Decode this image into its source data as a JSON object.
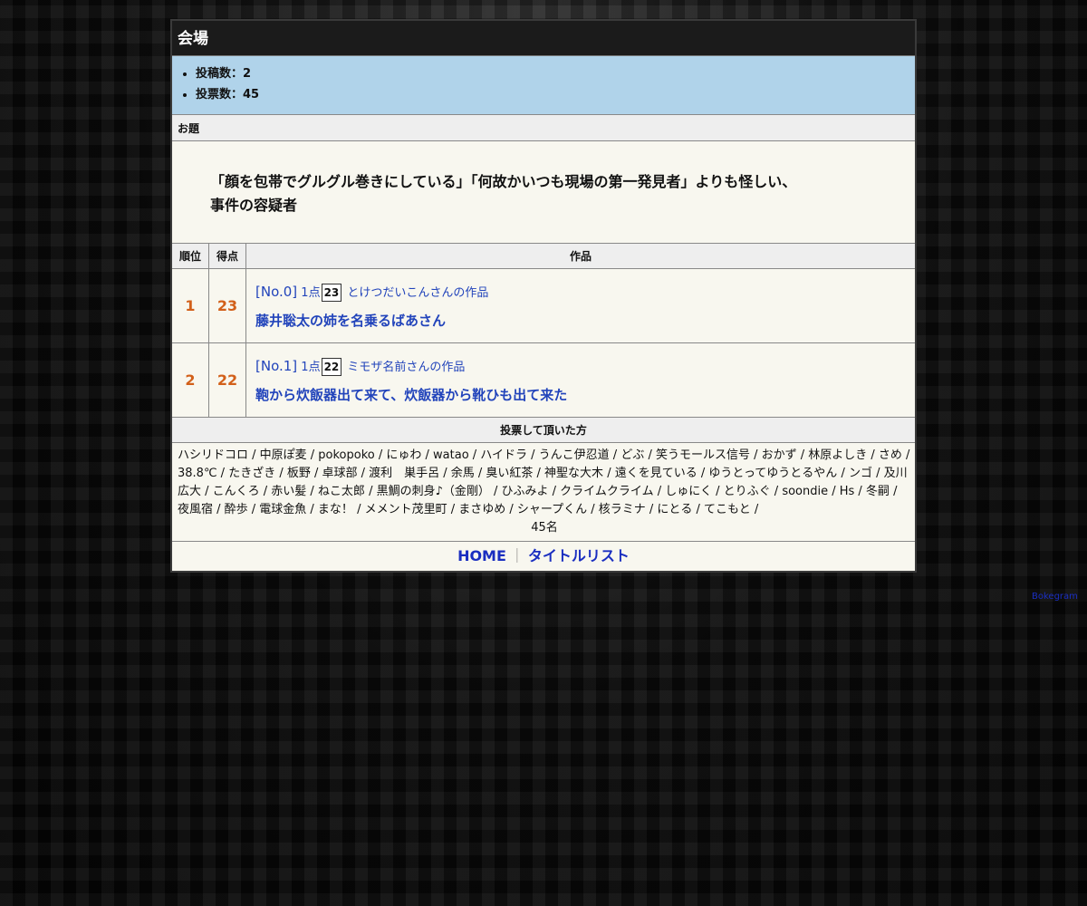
{
  "venue": {
    "title": "会場",
    "stats": [
      "投稿数：2",
      "投票数：45"
    ]
  },
  "theme": {
    "label": "お題",
    "line1": "「顔を包帯でグルグル巻きにしている」「何故かいつも現場の第一発見者」よりも怪しい、",
    "line2": "事件の容疑者"
  },
  "ranking": {
    "headers": {
      "rank": "順位",
      "points": "得点",
      "work": "作品"
    },
    "rows": [
      {
        "rank": "1",
        "points": "23",
        "no": "[No.0]",
        "per": "1点",
        "score": "23",
        "author": "とけつだいこんさんの作品",
        "title": "藤井聡太の姉を名乗るばあさん"
      },
      {
        "rank": "2",
        "points": "22",
        "no": "[No.1]",
        "per": "1点",
        "score": "22",
        "author": "ミモザ名前さんの作品",
        "title": "鞄から炊飯器出て来て、炊飯器から靴ひも出て来た"
      }
    ]
  },
  "voters": {
    "label": "投票して頂いた方",
    "list": "ハシリドコロ / 中原ぽ麦 / pokopoko / にゅわ / watao / ハイドラ / うんこ伊忍道 / どぶ / 笑うモールス信号 / おかず / 林原よしき / さめ / 38.8℃ / たきざき / 板野 / 卓球部 / 渡利　巣手呂 / 余馬 / 臭い紅茶 / 神聖な大木 / 遠くを見ている / ゆうとってゆうとるやん / ンゴ / 及川広大 / こんくろ / 赤い髪 / ねこ太郎 / 黒鯛の刺身♪（金剛） / ひふみよ / クライムクライム / しゅにく / とりふぐ / soondie / Hs / 冬嗣 / 夜風宿 / 酔歩 / 電球金魚 / まな！ / メメント茂里町 / まさゆめ / シャープくん / 核ラミナ / にとる / てこもと /",
    "count": "45名"
  },
  "nav": {
    "home": "HOME",
    "separator": "｜",
    "titles": "タイトルリスト"
  },
  "credit": "Bokegram"
}
